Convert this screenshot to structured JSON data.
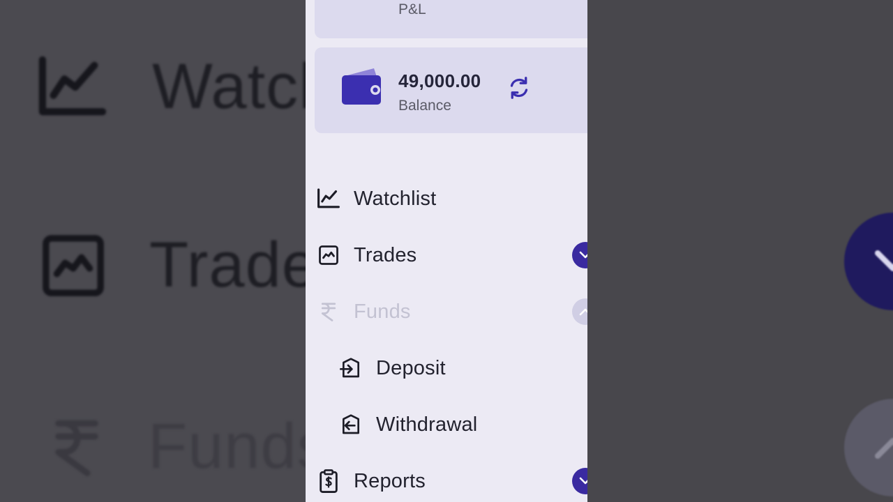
{
  "cards": {
    "pl": {
      "caption": "P&L"
    },
    "balance": {
      "amount": "49,000.00",
      "caption": "Balance"
    }
  },
  "menu": {
    "watchlist": "Watchlist",
    "trades": "Trades",
    "funds": "Funds",
    "deposit": "Deposit",
    "withdrawal": "Withdrawal",
    "reports": "Reports"
  },
  "colors": {
    "accent": "#3a2aa0",
    "drawer_bg": "#eceaf4",
    "card_bg": "#dcdaee",
    "disabled_text": "#c3c2d2"
  },
  "icons": [
    "wallet-icon",
    "refresh-icon",
    "line-chart-icon",
    "trade-chart-icon",
    "rupee-icon",
    "deposit-icon",
    "withdrawal-icon",
    "report-clipboard-icon",
    "chevron-down-icon"
  ]
}
